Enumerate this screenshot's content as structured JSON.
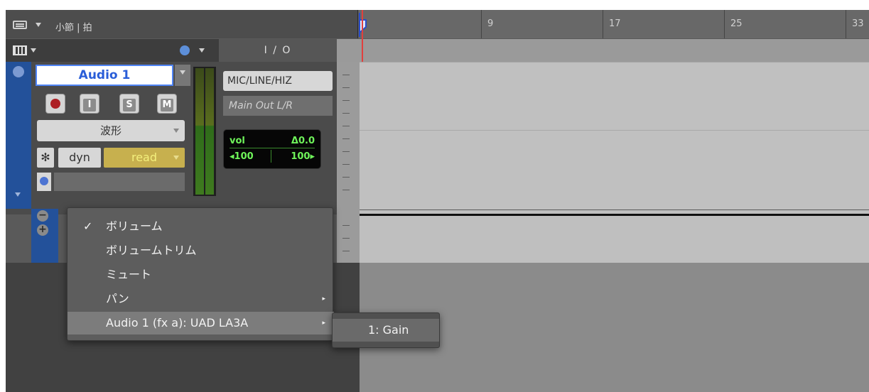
{
  "ruler": {
    "label": "小節 | 拍",
    "bars": [
      "9",
      "17",
      "25",
      "33"
    ]
  },
  "columns": {
    "io_header": "I / O"
  },
  "track": {
    "name": "Audio 1",
    "buttons": {
      "record": "",
      "input": "I",
      "solo": "S",
      "mute": "M"
    },
    "view": "波形",
    "star": "✻",
    "dyn": "dyn",
    "automation_mode": "read",
    "input": "MIC/LINE/HIZ",
    "output": "Main Out L/R",
    "vol_label": "vol",
    "vol_value": "Δ0.0",
    "pan_left": "◂100",
    "pan_right": "100▸"
  },
  "menu": {
    "items": [
      {
        "label": "ボリューム",
        "checked": true,
        "submenu": false
      },
      {
        "label": "ボリュームトリム",
        "checked": false,
        "submenu": false
      },
      {
        "label": "ミュート",
        "checked": false,
        "submenu": false
      },
      {
        "label": "パン",
        "checked": false,
        "submenu": true
      },
      {
        "label": "Audio 1  (fx a): UAD LA3A",
        "checked": false,
        "submenu": true
      }
    ],
    "check_mark": "✓",
    "arrow_mark": "▸"
  },
  "submenu": {
    "items": [
      {
        "label": "1: Gain"
      }
    ]
  },
  "colors": {
    "track_blue": "#23519a",
    "name_text": "#2a5ed8",
    "automation_read": "#c7b04e",
    "vol_text": "#6ff45a",
    "playhead": "#e0403e",
    "meter_green": "#3f7a1f",
    "meter_olive": "#6c7d1a"
  },
  "icons": [
    "bars-icon",
    "column-icon",
    "clock-icon",
    "record-icon",
    "blue-circle-icon",
    "minus-icon",
    "plus-icon",
    "playhead-flag-icon"
  ]
}
